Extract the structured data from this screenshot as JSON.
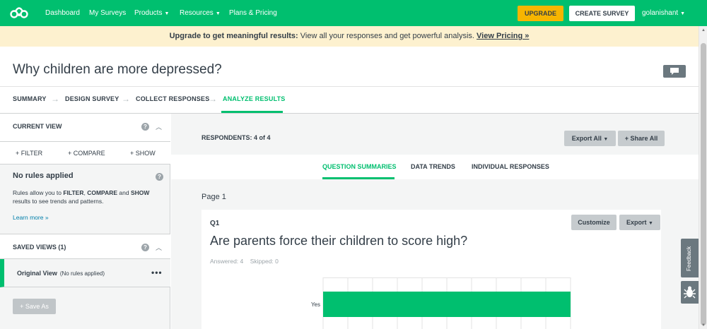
{
  "nav": {
    "logo_icon": "surveymonkey-logo-icon",
    "items": [
      {
        "label": "Dashboard"
      },
      {
        "label": "My Surveys"
      },
      {
        "label": "Products"
      },
      {
        "label": "Resources"
      },
      {
        "label": "Plans & Pricing"
      }
    ],
    "upgrade_label": "UPGRADE",
    "create_label": "CREATE SURVEY",
    "username": "golanishant"
  },
  "banner": {
    "bold": "Upgrade to get meaningful results:",
    "text": " View all your responses and get powerful analysis. ",
    "link": "View Pricing »"
  },
  "survey": {
    "title": "Why children are more depressed?"
  },
  "steps": [
    {
      "label": "SUMMARY"
    },
    {
      "label": "DESIGN SURVEY"
    },
    {
      "label": "COLLECT RESPONSES"
    },
    {
      "label": "ANALYZE RESULTS"
    }
  ],
  "left": {
    "current_view": "CURRENT VIEW",
    "filter": "+ FILTER",
    "compare": "+ COMPARE",
    "show": "+ SHOW",
    "rules_title": "No rules applied",
    "rules_text_1": "Rules allow you to ",
    "rules_filter": "FILTER",
    "rules_sep1": ", ",
    "rules_compare": "COMPARE",
    "rules_sep2": " and ",
    "rules_show": "SHOW",
    "rules_text_2": " results to see trends and patterns.",
    "learn_more": "Learn more »",
    "saved_views": "SAVED VIEWS (1)",
    "saved_item_name": "Original View",
    "saved_item_note": "(No rules applied)",
    "more_icon": "•••",
    "save_as": "+ Save As"
  },
  "main": {
    "respondents": "RESPONDENTS: 4 of 4",
    "export_all": "Export All",
    "share_all": "+ Share All",
    "tabs": [
      {
        "label": "QUESTION SUMMARIES"
      },
      {
        "label": "DATA TRENDS"
      },
      {
        "label": "INDIVIDUAL RESPONSES"
      }
    ],
    "page_label": "Page 1",
    "question": {
      "number": "Q1",
      "title": "Are parents force their children to score high?",
      "answered": "Answered: 4",
      "skipped": "Skipped: 0",
      "customize": "Customize",
      "export": "Export"
    }
  },
  "chart_data": {
    "type": "bar",
    "orientation": "horizontal",
    "categories": [
      "Yes"
    ],
    "values": [
      100
    ],
    "xlim": [
      0,
      100
    ],
    "grid": true
  },
  "side": {
    "feedback": "Feedback",
    "bug_icon": "bug-icon"
  },
  "colors": {
    "brand": "#00bf6f",
    "upgrade": "#f7b500",
    "banner_bg": "#fdf1cf"
  }
}
